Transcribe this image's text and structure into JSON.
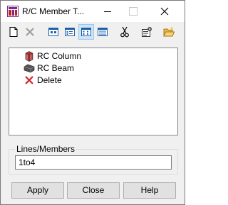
{
  "window": {
    "title": "R/C Member T...",
    "icons": {
      "app": "rc-member-app-icon",
      "minimize": "minimize-icon",
      "maximize": "maximize-icon",
      "close": "close-icon"
    }
  },
  "toolbar": {
    "buttons": [
      {
        "name": "new-icon"
      },
      {
        "name": "delete-x-icon"
      },
      {
        "name": "view-large-icons-icon"
      },
      {
        "name": "view-small-icons-icon"
      },
      {
        "name": "view-list-icon",
        "active": true
      },
      {
        "name": "view-details-icon"
      },
      {
        "name": "cut-icon"
      },
      {
        "name": "properties-icon"
      },
      {
        "name": "open-folder-icon"
      }
    ]
  },
  "tree": {
    "items": [
      {
        "label": "RC Column",
        "icon": "rc-column-icon"
      },
      {
        "label": "RC Beam",
        "icon": "rc-beam-icon"
      },
      {
        "label": "Delete",
        "icon": "delete-red-x-icon"
      }
    ]
  },
  "lines_members": {
    "label": "Lines/Members",
    "value": "1to4"
  },
  "buttons": {
    "apply": "Apply",
    "close": "Close",
    "help": "Help"
  },
  "colors": {
    "selection_bg": "#cce4f7",
    "delete_red": "#d42020"
  }
}
